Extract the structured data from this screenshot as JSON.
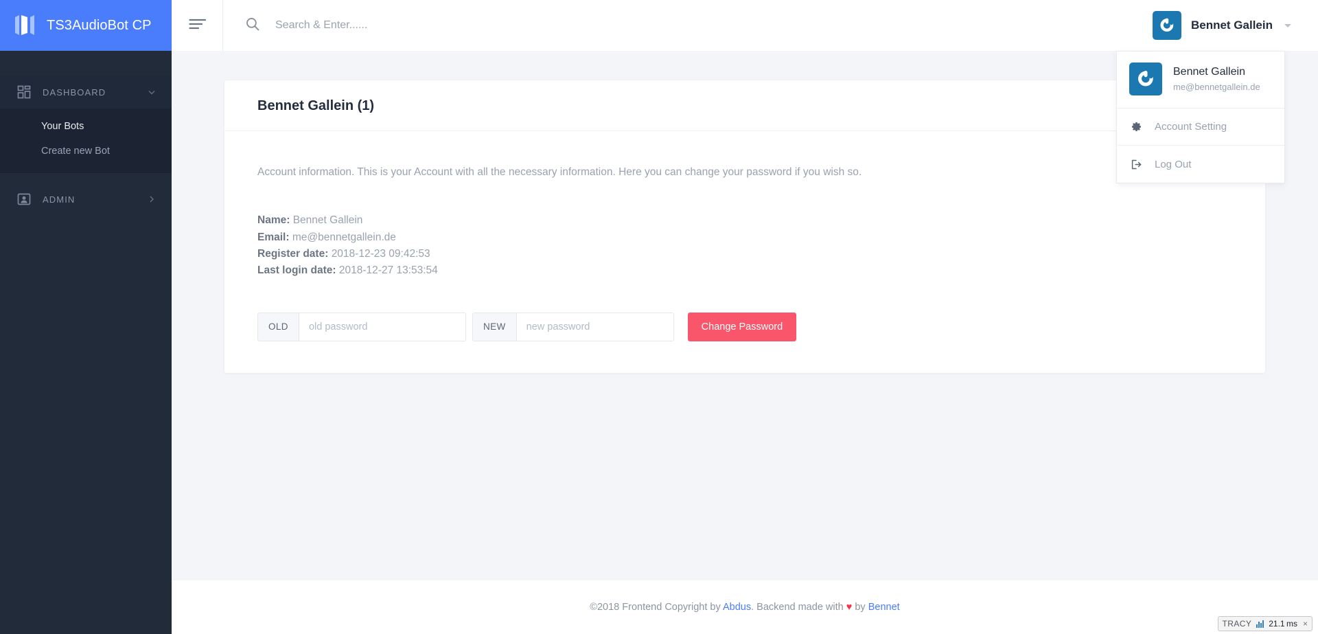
{
  "brand": {
    "title": "TS3AudioBot CP",
    "logo_icon": "ts3-bars-logo-icon"
  },
  "sidebar": {
    "groups": [
      {
        "label": "DASHBOARD",
        "icon": "grid-dashboard-icon",
        "caret": "chevron-down-icon",
        "expanded": true,
        "items": [
          {
            "label": "Your Bots",
            "current": true
          },
          {
            "label": "Create new Bot",
            "current": false
          }
        ]
      },
      {
        "label": "ADMIN",
        "icon": "user-card-icon",
        "caret": "chevron-right-icon",
        "expanded": false,
        "items": []
      }
    ]
  },
  "topbar": {
    "menu_toggle_icon": "hamburger-icon",
    "search": {
      "icon": "search-icon",
      "placeholder": "Search & Enter......",
      "value": ""
    },
    "user": {
      "name": "Bennet Gallein",
      "avatar_icon": "gravatar-avatar-icon",
      "avatar_color": "#1b78b0",
      "caret_icon": "caret-down-icon"
    }
  },
  "user_dropdown": {
    "open": true,
    "name": "Bennet Gallein",
    "email": "me@bennetgallein.de",
    "avatar_icon": "gravatar-avatar-icon",
    "items": [
      {
        "label": "Account Setting",
        "icon": "gear-icon"
      },
      {
        "label": "Log Out",
        "icon": "logout-icon"
      }
    ]
  },
  "card": {
    "title": "Bennet Gallein (1)",
    "lead": "Account information. This is your Account with all the necessary information. Here you can change your password if you wish so.",
    "info": [
      {
        "label": "Name:",
        "value": "Bennet Gallein"
      },
      {
        "label": "Email:",
        "value": "me@bennetgallein.de"
      },
      {
        "label": "Register date:",
        "value": "2018-12-23 09:42:53"
      },
      {
        "label": "Last login date:",
        "value": "2018-12-27 13:53:54"
      }
    ],
    "password_form": {
      "old_addon": "OLD",
      "old_placeholder": "old password",
      "old_value": "",
      "new_addon": "NEW",
      "new_placeholder": "new password",
      "new_value": "",
      "submit_label": "Change Password",
      "submit_color": "#f9566c"
    }
  },
  "footer": {
    "copyright_prefix": "©2018 Frontend Copyright by ",
    "frontend_author": "Abdus",
    "middle": ". Backend made with ",
    "heart": "♥",
    "by": " by ",
    "backend_author": "Bennet"
  },
  "tracy_bar": {
    "label": "TRACY",
    "chart_icon": "bar-chart-icon",
    "time": "21.1 ms",
    "close": "×"
  }
}
